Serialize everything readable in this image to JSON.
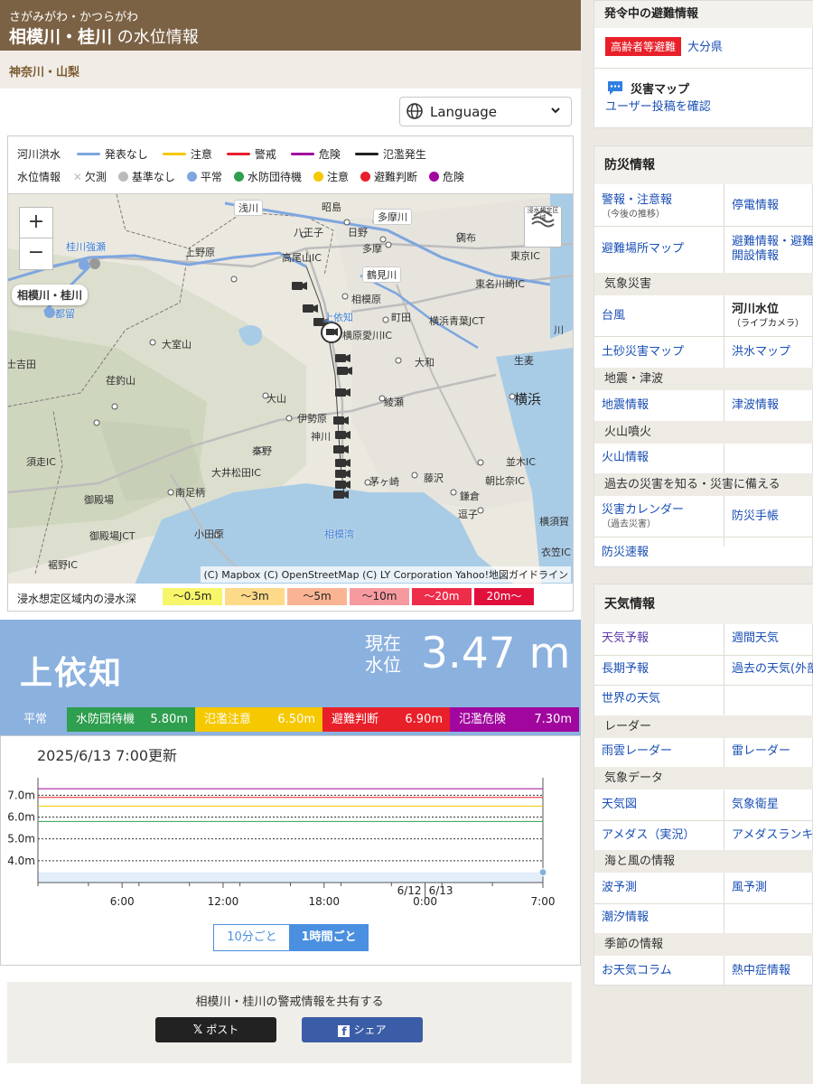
{
  "header": {
    "ruby": "さがみがわ・かつらがわ",
    "title_bold": "相模川・桂川",
    "title_rest": "の水位情報",
    "area": "神奈川・山梨"
  },
  "language": {
    "label": "Language"
  },
  "legend": {
    "river_flood_label": "河川洪水",
    "river_items": [
      {
        "label": "発表なし",
        "color": "#7ea6e0"
      },
      {
        "label": "注意",
        "color": "#f5c800"
      },
      {
        "label": "警戒",
        "color": "#e8202a"
      },
      {
        "label": "危険",
        "color": "#a1069e"
      },
      {
        "label": "氾濫発生",
        "color": "#222222"
      }
    ],
    "level_label": "水位情報",
    "level_items": [
      {
        "label": "欠測",
        "color": "#bbbbbb",
        "shape": "x"
      },
      {
        "label": "基準なし",
        "color": "#bbbbbb"
      },
      {
        "label": "平常",
        "color": "#7ea6e0"
      },
      {
        "label": "水防団待機",
        "color": "#2e9e4f"
      },
      {
        "label": "注意",
        "color": "#f5c800"
      },
      {
        "label": "避難判断",
        "color": "#e8202a"
      },
      {
        "label": "危険",
        "color": "#a1069e"
      }
    ]
  },
  "map": {
    "labels": [
      "浅川",
      "昭島",
      "多摩川",
      "八王子",
      "日野",
      "調布",
      "桂川強瀬",
      "上野原",
      "多摩",
      "高尾山IC",
      "東京IC",
      "鶴見川",
      "相模川・桂川",
      "相模原",
      "東名川崎IC",
      "上依知",
      "町田",
      "都留",
      "横浜青葉JCT",
      "横原愛川IC",
      "川",
      "大室山",
      "大和",
      "士吉田",
      "荏釣山",
      "生麦",
      "大山",
      "綾瀬",
      "横浜",
      "伊勢原",
      "神川",
      "秦野",
      "須走IC",
      "大井松田IC",
      "並木IC",
      "茅ヶ崎",
      "藤沢",
      "朝比奈IC",
      "御殿場",
      "南足柄",
      "鎌倉",
      "逗子",
      "横須賀",
      "御殿場JCT",
      "小田原",
      "相模湾",
      "衣笠IC",
      "裾野IC",
      "浸水想定区域"
    ],
    "zoom_in": "+",
    "zoom_out": "−",
    "attribution": "(C) Mapbox (C) OpenStreetMap (C) LY Corporation Yahoo!地図ガイドライン"
  },
  "depth_legend": {
    "label": "浸水想定区域内の浸水深",
    "items": [
      {
        "label": "〜0.5m",
        "color": "#f7f56a"
      },
      {
        "label": "〜3m",
        "color": "#fdd98a"
      },
      {
        "label": "〜5m",
        "color": "#fbb493"
      },
      {
        "label": "〜10m",
        "color": "#f79aa0"
      },
      {
        "label": "〜20m",
        "color": "#ee2d4b"
      },
      {
        "label": "20m〜",
        "color": "#e0103a"
      }
    ]
  },
  "station": {
    "name": "上依知",
    "now_label_1": "現在",
    "now_label_2": "水位",
    "level": "3.47 m",
    "bands": [
      {
        "name": "平常",
        "value": "",
        "color": "#8bb1df"
      },
      {
        "name": "水防団待機",
        "value": "5.80m",
        "color": "#2e9e4f"
      },
      {
        "name": "氾濫注意",
        "value": "6.50m",
        "color": "#f5c800"
      },
      {
        "name": "避難判断",
        "value": "6.90m",
        "color": "#e8202a"
      },
      {
        "name": "氾濫危険",
        "value": "7.30m",
        "color": "#a1069e"
      }
    ]
  },
  "chart_data": {
    "type": "line",
    "updated": "2025/6/13 7:00更新",
    "y_ticks": [
      "7.0m",
      "6.0m",
      "5.0m",
      "4.0m"
    ],
    "x_ticks": [
      "6:00",
      "12:00",
      "18:00",
      "0:00",
      "7:00"
    ],
    "date_labels": [
      "6/12",
      "6/13"
    ],
    "thresholds": [
      {
        "name": "水防団待機",
        "value": 5.8,
        "color": "#2e9e4f"
      },
      {
        "name": "氾濫注意",
        "value": 6.5,
        "color": "#f5c800"
      },
      {
        "name": "避難判断",
        "value": 6.9,
        "color": "#e8202a"
      },
      {
        "name": "氾濫危険",
        "value": 7.3,
        "color": "#a1069e"
      }
    ],
    "current_value": 3.47,
    "ylim": [
      3.0,
      7.8
    ]
  },
  "interval_toggle": {
    "ten_min": "10分ごと",
    "hourly": "1時間ごと"
  },
  "share": {
    "title": "相模川・桂川の警戒情報を共有する",
    "x_label": "ポスト",
    "fb_label": "シェア"
  },
  "sidebar": {
    "evac_title": "発令中の避難情報",
    "evac_badge": "高齢者等避難",
    "evac_place": "大分県",
    "hazard_title": "災害マップ",
    "hazard_link": "ユーザー投稿を確認",
    "bousai_title": "防災情報",
    "bousai": {
      "keihou": "警報・注意報",
      "keihou_sub": "（今後の推移）",
      "teiden": "停電情報",
      "hinan_map": "避難場所マップ",
      "hinan_joho_1": "避難情報・避難所",
      "hinan_joho_2": "開設情報",
      "sec_kishou": "気象災害",
      "taifu": "台風",
      "kasen_1": "河川水位",
      "kasen_2": "（ライブカメラ）",
      "dosha": "土砂災害マップ",
      "kouzui": "洪水マップ",
      "sec_jishin": "地震・津波",
      "jishin": "地震情報",
      "tsunami": "津波情報",
      "sec_kazan": "火山噴火",
      "kazan": "火山情報",
      "sec_kako": "過去の災害を知る・災害に備える",
      "calendar": "災害カレンダー",
      "calendar_sub": "（過去災害）",
      "techou": "防災手帳",
      "sokuhou": "防災速報"
    },
    "tenki_title": "天気情報",
    "tenki": {
      "yohou": "天気予報",
      "shukan": "週間天気",
      "choki": "長期予報",
      "kako": "過去の天気(外部サイト)",
      "sekai": "世界の天気",
      "sec_radar": "レーダー",
      "amagumo": "雨雲レーダー",
      "kaminari": "雷レーダー",
      "sec_kishou": "気象データ",
      "tenkizu": "天気図",
      "eisei": "気象衛星",
      "amedas": "アメダス（実況）",
      "amedas_rank": "アメダスランキング",
      "sec_umi": "海と風の情報",
      "nami": "波予測",
      "kaze": "風予測",
      "choseki": "潮汐情報",
      "sec_kisetsu": "季節の情報",
      "column": "お天気コラム",
      "necchu": "熱中症情報"
    }
  }
}
